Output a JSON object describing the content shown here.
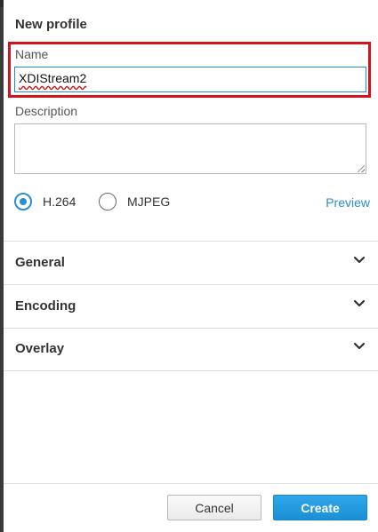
{
  "dialog": {
    "title": "New profile"
  },
  "name_field": {
    "label": "Name",
    "value": "XDIStream2"
  },
  "description_field": {
    "label": "Description",
    "value": ""
  },
  "codec": {
    "options": [
      {
        "label": "H.264",
        "selected": true
      },
      {
        "label": "MJPEG",
        "selected": false
      }
    ],
    "preview_label": "Preview"
  },
  "sections": [
    {
      "label": "General",
      "icon": "chevron-down-icon"
    },
    {
      "label": "Encoding",
      "icon": "chevron-down-icon"
    },
    {
      "label": "Overlay",
      "icon": "chevron-down-icon"
    }
  ],
  "buttons": {
    "cancel_label": "Cancel",
    "create_label": "Create"
  },
  "colors": {
    "accent": "#2a8ed0",
    "highlight": "#d3121c",
    "primary_button": "#1a8fd6"
  }
}
